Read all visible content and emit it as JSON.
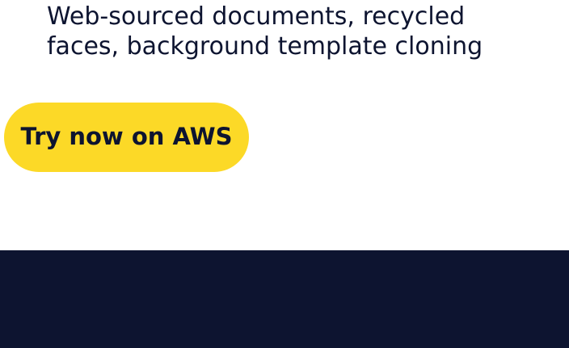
{
  "description": {
    "line1": "Web-sourced documents, recycled",
    "line2": "faces, background template cloning"
  },
  "cta": {
    "label": "Try now on AWS"
  },
  "colors": {
    "text": "#0d1430",
    "button_bg": "#fcd927",
    "footer_bg": "#0d1430",
    "page_bg": "#ffffff"
  }
}
